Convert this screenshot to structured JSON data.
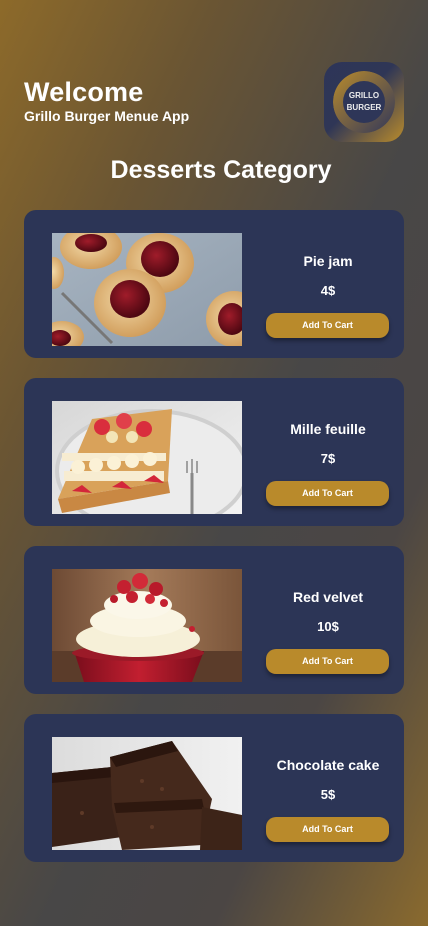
{
  "header": {
    "welcome": "Welcome",
    "app_name": "Grillo Burger Menue App"
  },
  "logo": {
    "line1": "GRILLO",
    "line2": "BURGER"
  },
  "category_title": "Desserts Category",
  "items": [
    {
      "name": "Pie jam",
      "price": "4$",
      "button": "Add To Cart"
    },
    {
      "name": "Mille feuille",
      "price": "7$",
      "button": "Add To Cart"
    },
    {
      "name": "Red velvet",
      "price": "10$",
      "button": "Add To Cart"
    },
    {
      "name": "Chocolate cake",
      "price": "5$",
      "button": "Add To Cart"
    }
  ],
  "colors": {
    "card": "#2c3556",
    "button": "#b98a2b",
    "accent_gold": "#8d6a2a"
  }
}
